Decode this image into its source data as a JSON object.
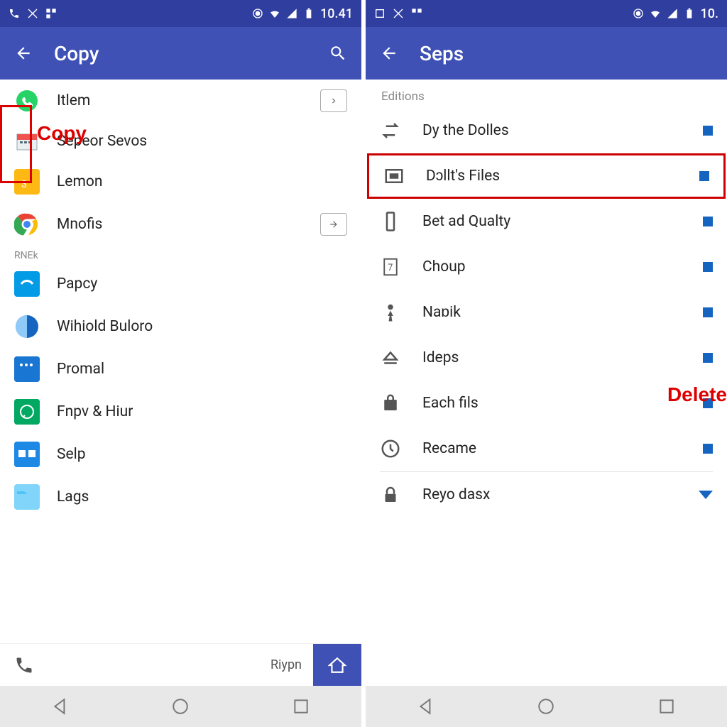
{
  "left": {
    "statusbar": {
      "time": "10.41"
    },
    "appbar": {
      "title": "Copy"
    },
    "annotation": "Copy",
    "items": [
      {
        "label": "Itlem",
        "icon": "whatsapp",
        "arrow": "right"
      },
      {
        "label": "Sepeor Sevos",
        "icon": "calendar"
      },
      {
        "label": "Lemon",
        "icon": "yellow-folder"
      },
      {
        "label": "Mnofis",
        "icon": "chrome",
        "arrow": "arrow-right"
      }
    ],
    "section2_hdr": "RNEk",
    "items2": [
      {
        "label": "Papcy",
        "icon": "blue-app"
      },
      {
        "label": "Wihiold Buloro",
        "icon": "split-circle"
      },
      {
        "label": "Promal",
        "icon": "blue-card"
      },
      {
        "label": "Fnpv & Hiur",
        "icon": "green-whatsapp"
      },
      {
        "label": "Selp",
        "icon": "blue-r"
      },
      {
        "label": "Lags",
        "icon": "folder"
      }
    ],
    "footer": {
      "text": "Riypn"
    }
  },
  "right": {
    "statusbar": {
      "time": "10."
    },
    "appbar": {
      "title": "Seps"
    },
    "annotation": "Delete",
    "section_hdr": "Editions",
    "items": [
      {
        "label": "Dy the Dolles",
        "icon": "transfer",
        "highlighted": false
      },
      {
        "label": "Dɔllt's Files",
        "icon": "square",
        "highlighted": true
      },
      {
        "label": "Bet ad Qualty",
        "icon": "phone-rect"
      },
      {
        "label": "Choup",
        "icon": "num7"
      },
      {
        "label": "Naɒik",
        "icon": "chess"
      },
      {
        "label": "Ideps",
        "icon": "eject"
      },
      {
        "label": "Each fils",
        "icon": "bag"
      },
      {
        "label": "Recame",
        "icon": "clock"
      }
    ],
    "items2": [
      {
        "label": "Reyo dasx",
        "icon": "lock",
        "dropdown": true
      }
    ]
  }
}
